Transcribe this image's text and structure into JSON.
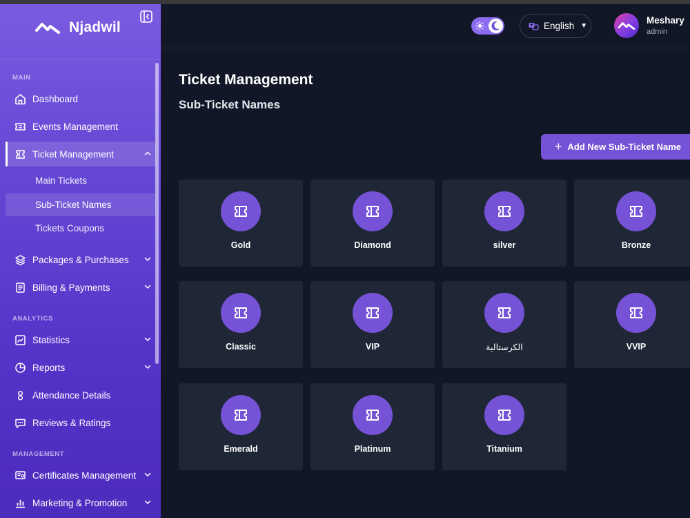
{
  "brand": {
    "name": "Njadwil"
  },
  "sidebar": {
    "sections": {
      "main": "MAIN",
      "analytics": "ANALYTICS",
      "management": "MANAGEMENT"
    },
    "items": {
      "dashboard": "Dashboard",
      "events": "Events Management",
      "tickets": "Ticket Management",
      "main_tickets": "Main Tickets",
      "sub_ticket_names": "Sub-Ticket Names",
      "tickets_coupons": "Tickets Coupons",
      "packages": "Packages & Purchases",
      "billing": "Billing & Payments",
      "statistics": "Statistics",
      "reports": "Reports",
      "attendance": "Attendance Details",
      "reviews": "Reviews & Ratings",
      "certificates": "Certificates Management",
      "marketing": "Marketing & Promotion"
    }
  },
  "header": {
    "language": "English",
    "user_name": "Meshary",
    "user_role": "admin"
  },
  "main": {
    "title": "Ticket Management",
    "subtitle": "Sub-Ticket Names",
    "add_button": "Add New Sub-Ticket Name",
    "sub_tickets": [
      "Gold",
      "Diamond",
      "silver",
      "Bronze",
      "Classic",
      "VIP",
      "الكرستالية",
      "VVIP",
      "Emerald",
      "Platinum",
      "Titanium"
    ]
  },
  "colors": {
    "accent": "#7552d6",
    "card_bg": "#1f2736",
    "page_bg": "#111726",
    "sidebar_top": "#7b5be0",
    "sidebar_bottom": "#4d2bbd"
  },
  "icons": {
    "sub_ticket": "ticket-icon",
    "add": "plus-icon",
    "language": "translate-icon",
    "theme_light": "sun-icon",
    "theme_dark": "moon-icon"
  }
}
